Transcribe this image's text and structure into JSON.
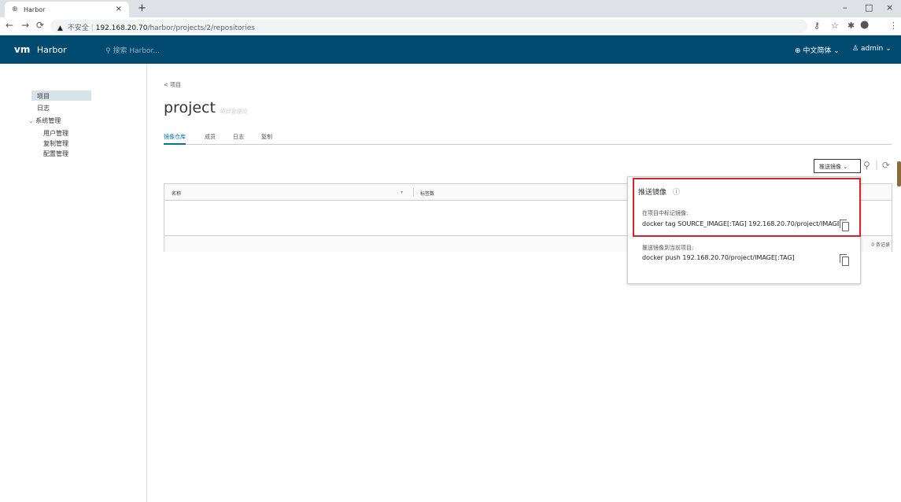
{
  "browser": {
    "tab_title": "Harbor",
    "new_tab": "+",
    "tab_close": "×",
    "security_warning": "不安全",
    "host": "192.168.20.70",
    "path": "/harbor/projects/2/repositories",
    "win_min": "–",
    "win_max": "□",
    "win_close": "×"
  },
  "header": {
    "logo": "vm",
    "app_name": "Harbor",
    "search_placeholder": "搜索 Harbor...",
    "language": "中文简体",
    "user": "admin"
  },
  "sidebar": {
    "projects": "项目",
    "logs": "日志",
    "admin_group": "系统管理",
    "user_mgmt": "用户管理",
    "replication_mgmt": "复制管理",
    "config_mgmt": "配置管理"
  },
  "main": {
    "breadcrumb": "< 项目",
    "project_name": "project",
    "role": "项目管理员",
    "tabs": [
      "镜像仓库",
      "成员",
      "日志",
      "复制"
    ],
    "push_button": "推送镜像"
  },
  "table": {
    "col_name": "名称",
    "col_tags": "标签数",
    "count": "0 条记录"
  },
  "popover": {
    "title": "推送镜像",
    "tag_label": "在项目中标记镜像:",
    "tag_command": "docker tag SOURCE_IMAGE[:TAG] 192.168.20.70/project/IMAGE[:TAG]",
    "push_label": "推送镜像到当前项目:",
    "push_command": "docker push 192.168.20.70/project/IMAGE[:TAG]"
  },
  "colors": {
    "header_bg": "#004a70",
    "highlight": "#d8232a",
    "accent": "#0072a3"
  }
}
